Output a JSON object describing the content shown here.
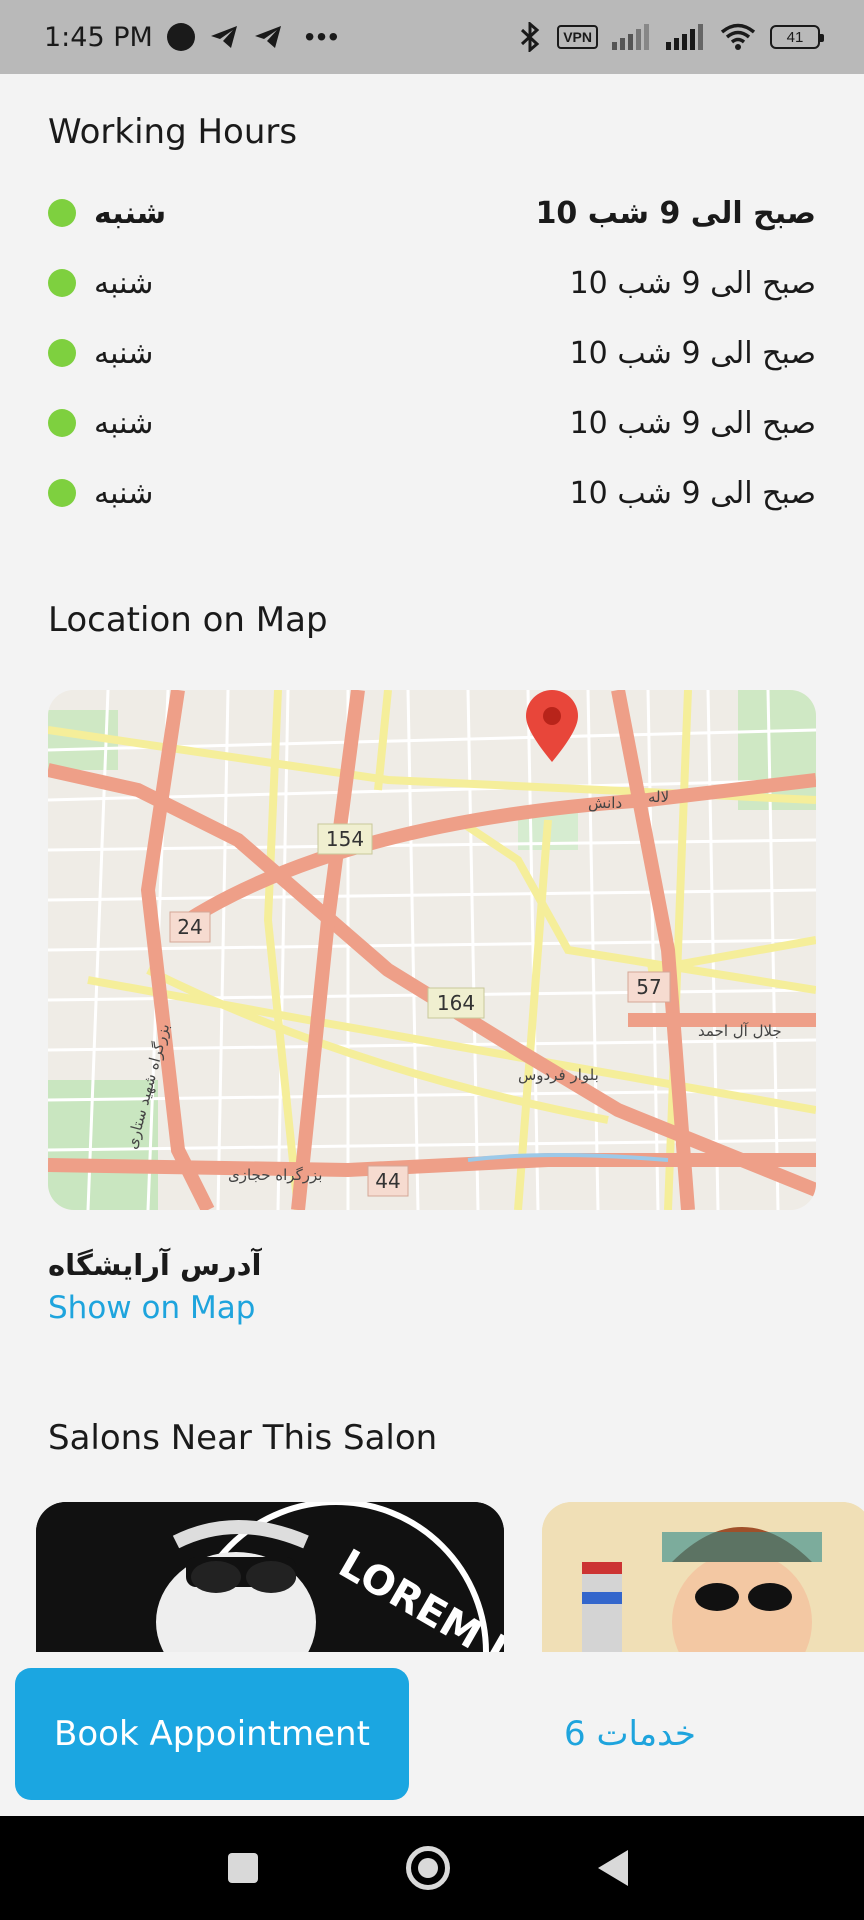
{
  "status_bar": {
    "time": "1:45 PM",
    "vpn": "VPN",
    "battery": "41",
    "icons": [
      "record-dot-icon",
      "telegram-icon",
      "telegram-icon",
      "more-icon",
      "bluetooth-icon",
      "vpn-icon",
      "signal-icon",
      "signal-icon",
      "wifi-icon",
      "battery-icon"
    ]
  },
  "working_hours": {
    "title": "Working Hours",
    "rows": [
      {
        "day": "شنبه",
        "time": "صبح الی 9 شب 10",
        "bold": true
      },
      {
        "day": "شنبه",
        "time": "صبح الی 9 شب 10"
      },
      {
        "day": "شنبه",
        "time": "صبح الی 9 شب 10"
      },
      {
        "day": "شنبه",
        "time": "صبح الی 9 شب 10"
      },
      {
        "day": "شنبه",
        "time": "صبح الی 9 شب 10"
      }
    ],
    "status_color": "#7ed03f"
  },
  "location": {
    "title": "Location on Map",
    "map_labels": {
      "r154": "154",
      "r24": "24",
      "r164": "164",
      "r57": "57",
      "r44": "44",
      "street_ferdows": "بلوار فردوس",
      "street_sattari": "بزرگراه شهید ستاری",
      "street_laleh": "لاله",
      "street_daneshe": "دانش",
      "street_jalal": "جلال آل احمد",
      "street_hejazi": "بزرگراه حجازی"
    },
    "address": "آدرس آرایشگاه",
    "show_on_map": "Show on Map",
    "accent_color": "#1ea4dd",
    "marker_color": "#e8463a"
  },
  "nearby": {
    "title": "Salons Near This Salon",
    "card1_text": "LOREM IP"
  },
  "actions": {
    "book": "Book Appointment",
    "services": "خدمات 6",
    "button_color": "#1ba6e1"
  }
}
